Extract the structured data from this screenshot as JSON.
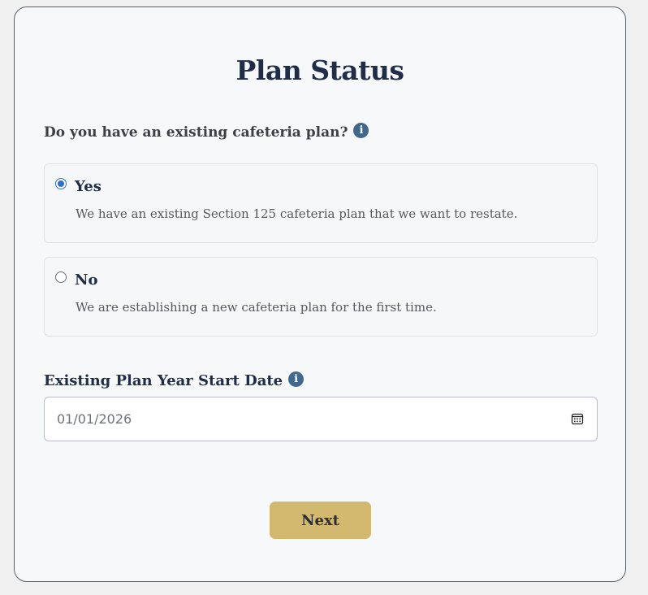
{
  "page": {
    "title": "Plan Status"
  },
  "question": {
    "text": "Do you have an existing cafeteria plan?",
    "info_icon": "info-icon"
  },
  "options": [
    {
      "label": "Yes",
      "description": "We have an existing Section 125 cafeteria plan that we want to restate.",
      "selected": true
    },
    {
      "label": "No",
      "description": "We are establishing a new cafeteria plan for the first time.",
      "selected": false
    }
  ],
  "date_field": {
    "label": "Existing Plan Year Start Date",
    "value": "01/01/2026",
    "icon": "calendar-icon"
  },
  "actions": {
    "next_label": "Next"
  },
  "colors": {
    "title": "#1f2d48",
    "info_icon": "#40688f",
    "radio_selected": "#2f6fd0",
    "next_button": "#d3b86f"
  }
}
